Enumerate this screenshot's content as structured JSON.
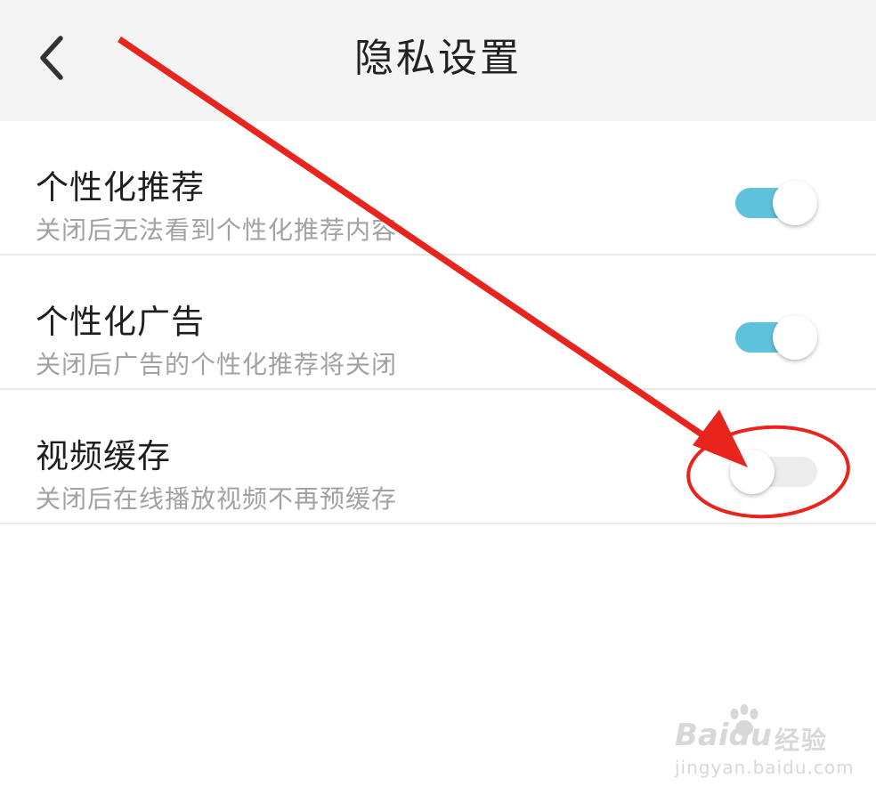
{
  "header": {
    "title": "隐私设置",
    "back_icon": "chevron-left-icon",
    "background": "#f4f4f4"
  },
  "settings": [
    {
      "title": "个性化推荐",
      "desc": "关闭后无法看到个性化推荐内容",
      "enabled": true
    },
    {
      "title": "个性化广告",
      "desc": "关闭后广告的个性化推荐将关闭",
      "enabled": true
    },
    {
      "title": "视频缓存",
      "desc": "关闭后在线播放视频不再预缓存",
      "enabled": false
    }
  ],
  "colors": {
    "toggle_on": "#5fc2dc",
    "toggle_off": "#ececec",
    "annotation": "#e8241c",
    "title_text": "#1f1f1f",
    "desc_text": "#a2a2a2"
  },
  "annotation": {
    "arrow_icon": "red-arrow-annotation",
    "circle_icon": "red-circle-annotation"
  },
  "watermark": {
    "logo": "Baidu",
    "text": "经验",
    "url": "jingyan.baidu.com"
  }
}
